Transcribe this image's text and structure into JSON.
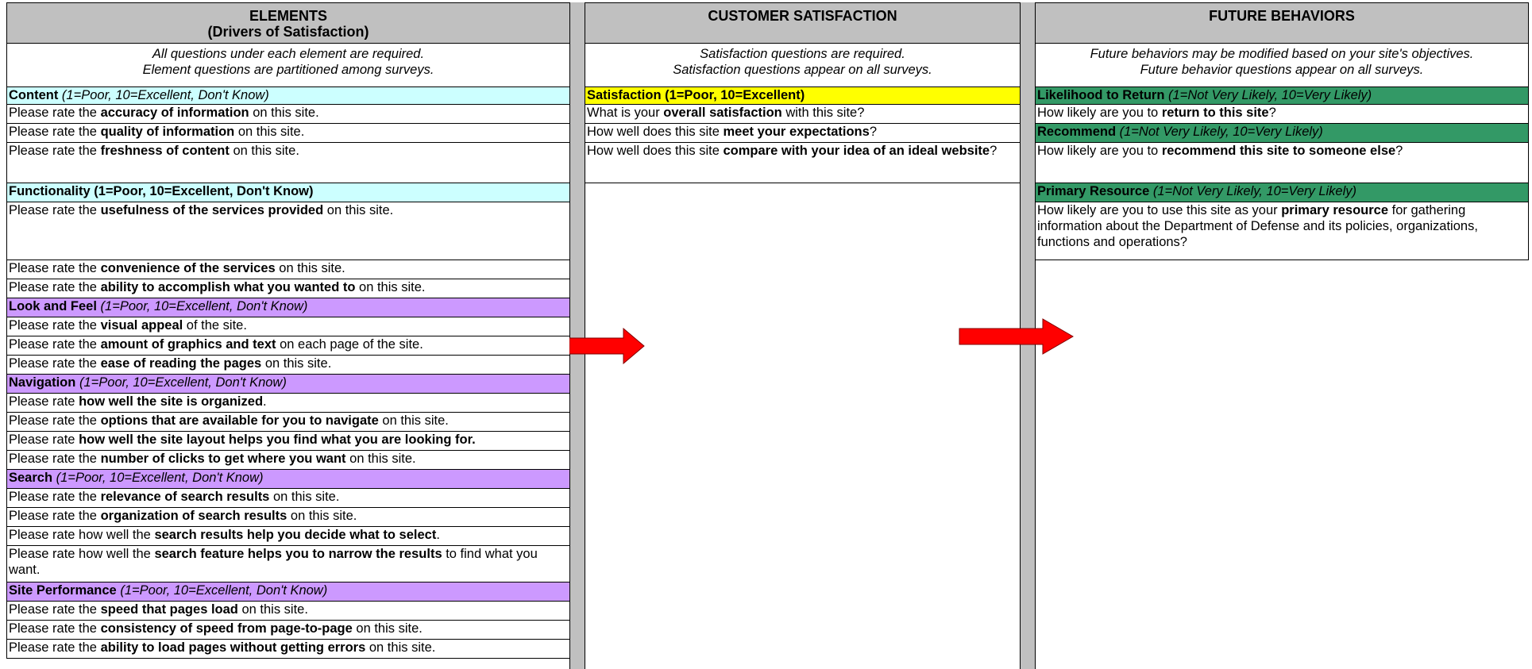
{
  "colors": {
    "header_bg": "#c0c0c0",
    "content_bg": "#ccffff",
    "functionality_bg": "#ccffff",
    "section_purple": "#cc99ff",
    "satisfaction_bg": "#ffff00",
    "future_bg": "#339966",
    "arrow": "#ff0000"
  },
  "elements": {
    "title_line1": "ELEMENTS",
    "title_line2": "(Drivers of Satisfaction)",
    "note_line1": "All questions under each element are required.",
    "note_line2": "Element questions are partitioned among surveys.",
    "content": {
      "label": "Content",
      "scale": "(1=Poor, 10=Excellent, Don't Know)",
      "q1_pre": "Please rate the ",
      "q1_bold": "accuracy of information",
      "q1_post": " on this site.",
      "q2_pre": "Please rate the ",
      "q2_bold": "quality of information",
      "q2_post": " on this site.",
      "q3_pre": "Please rate the ",
      "q3_bold": "freshness of content",
      "q3_post": " on this site."
    },
    "functionality": {
      "label": "Functionality (1=Poor, 10=Excellent, Don't Know)",
      "q1_pre": "Please rate the ",
      "q1_bold": "usefulness of the services provided",
      "q1_post": " on this site.",
      "q2_pre": "Please rate the ",
      "q2_bold": "convenience of the services",
      "q2_post": " on this site.",
      "q3_pre": "Please rate the ",
      "q3_bold": "ability to accomplish what you wanted to",
      "q3_post": " on this site."
    },
    "look": {
      "label": "Look and Feel",
      "scale": "(1=Poor, 10=Excellent, Don't Know)",
      "q1_pre": "Please rate the ",
      "q1_bold": "visual appeal",
      "q1_post": " of the site.",
      "q2_pre": "Please rate the ",
      "q2_bold": "amount of graphics and text",
      "q2_post": " on each page of the site.",
      "q3_pre": "Please rate the ",
      "q3_bold": "ease of reading the pages",
      "q3_post": " on this site."
    },
    "navigation": {
      "label": "Navigation",
      "scale": "(1=Poor, 10=Excellent, Don't Know)",
      "q1_pre": "Please rate ",
      "q1_bold": "how well the site is organized",
      "q1_post": ".",
      "q2_pre": "Please rate the ",
      "q2_bold": "options that are available for you to navigate",
      "q2_post": " on this site.",
      "q3_pre": "Please rate ",
      "q3_bold": "how well the site layout helps you find what you are looking for.",
      "q3_post": "",
      "q4_pre": "Please rate the ",
      "q4_bold": "number of clicks to get where you want",
      "q4_post": " on this site."
    },
    "search": {
      "label": "Search",
      "scale": "(1=Poor, 10=Excellent, Don't Know)",
      "q1_pre": "Please rate the ",
      "q1_bold": "relevance of search results",
      "q1_post": " on this site.",
      "q2_pre": "Please rate the ",
      "q2_bold": "organization of search results",
      "q2_post": " on this site.",
      "q3_pre": "Please rate how well the ",
      "q3_bold": "search results help you decide what to select",
      "q3_post": ".",
      "q4_pre": "Please rate how well the ",
      "q4_bold": "search feature helps you to narrow the results",
      "q4_post": " to find what you want."
    },
    "performance": {
      "label": "Site Performance",
      "scale": "(1=Poor, 10=Excellent, Don't Know)",
      "q1_pre": "Please rate the ",
      "q1_bold": "speed that pages load",
      "q1_post": " on this site.",
      "q2_pre": "Please rate the ",
      "q2_bold": "consistency of speed from page-to-page",
      "q2_post": " on this site.",
      "q3_pre": "Please rate the ",
      "q3_bold": "ability to load pages without getting errors",
      "q3_post": " on this site."
    }
  },
  "satisfaction": {
    "title": "CUSTOMER SATISFACTION",
    "note_line1": "Satisfaction questions are required.",
    "note_line2": "Satisfaction questions appear on all surveys.",
    "label": "Satisfaction (1=Poor, 10=Excellent)",
    "q1_pre": "What is your ",
    "q1_bold": "overall satisfaction",
    "q1_post": " with this site?",
    "q2_pre": "How well does this site ",
    "q2_bold": "meet your expectations",
    "q2_post": "?",
    "q3_pre": "How well does this site ",
    "q3_bold": "compare with your idea of an ideal website",
    "q3_post": "?"
  },
  "future": {
    "title": "FUTURE BEHAVIORS",
    "note_line1": "Future behaviors may be modified based on your site's objectives.",
    "note_line2": "Future behavior questions appear on all surveys.",
    "return_label": "Likelihood to Return",
    "return_scale": "(1=Not Very Likely, 10=Very Likely)",
    "return_q_pre": "How likely are you to ",
    "return_q_bold": "return to this site",
    "return_q_post": "?",
    "recommend_label": "Recommend",
    "recommend_scale": "(1=Not Very Likely, 10=Very Likely)",
    "recommend_q_pre": "How likely are you to ",
    "recommend_q_bold": "recommend this site to someone else",
    "recommend_q_post": "?",
    "primary_label": "Primary Resource",
    "primary_scale": "(1=Not Very Likely, 10=Very Likely)",
    "primary_q_pre": "How likely are you to use this site as your ",
    "primary_q_bold": "primary resource",
    "primary_q_post": " for gathering information about the Department of Defense and its policies, organizations, functions and operations?"
  }
}
